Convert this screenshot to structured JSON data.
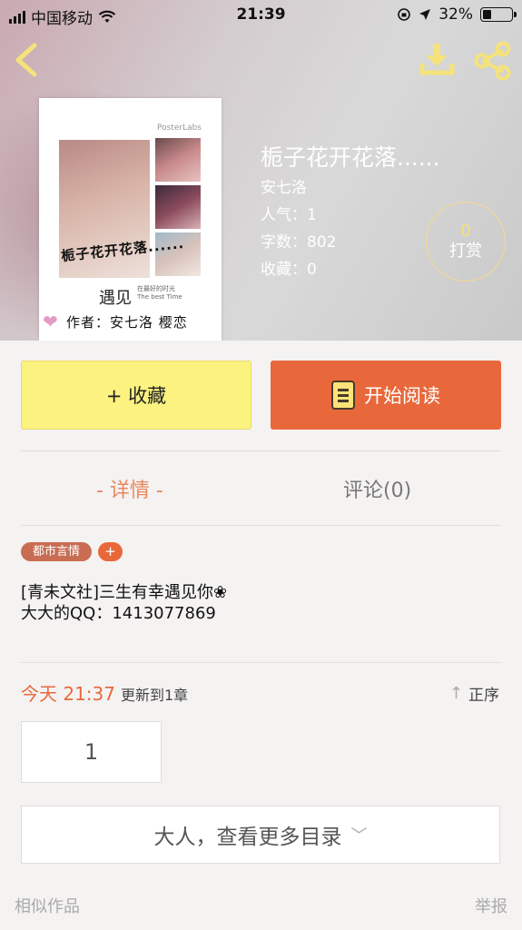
{
  "status_bar": {
    "carrier": "中国移动",
    "time": "21:39",
    "battery_percent": "32%",
    "battery_level": 0.32,
    "icons": [
      "signal-icon",
      "wifi-icon",
      "orientation-lock-icon",
      "location-icon",
      "battery-icon"
    ]
  },
  "header": {
    "back_icon": "chevron-left-icon",
    "download_icon": "download-icon",
    "share_icon": "share-icon",
    "accent_color": "#f5e27a"
  },
  "cover": {
    "brand": "PosterLabs",
    "title": "栀子花开花落......",
    "meet": "遇见",
    "subtitle_line1": "在最好的时光",
    "subtitle_line2": "The best Time",
    "author": "作者：安七洛 樱恋"
  },
  "book": {
    "title": "栀子花开花落......",
    "author": "安七洛",
    "popularity": "人气：1",
    "words": "字数：802",
    "favorites": "收藏：0"
  },
  "tip": {
    "count": "0",
    "label": "打赏"
  },
  "actions": {
    "favorite_label": "+ 收藏",
    "read_label": "开始阅读",
    "favorite_color": "#fbf27f",
    "read_color": "#e8683c"
  },
  "tabs": {
    "detail": "- 详情 -",
    "comments": "评论(0)"
  },
  "tags": {
    "genre": "都市言情",
    "add": "+"
  },
  "description": {
    "line1": "[青未文社]三生有幸遇见你❀",
    "line2": "大大的QQ：1413077869"
  },
  "update": {
    "today": "今天 21:37",
    "text": "更新到1章",
    "order_label": "正序"
  },
  "chapters": [
    "1"
  ],
  "more_catalog": "大人，查看更多目录",
  "footer": {
    "similar": "相似作品",
    "report": "举报"
  }
}
